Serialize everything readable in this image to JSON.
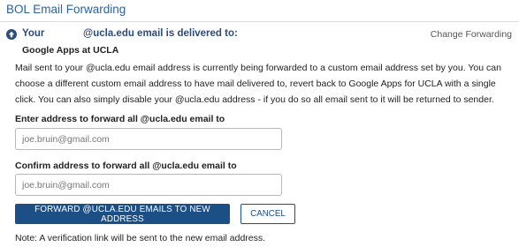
{
  "page": {
    "title": "BOL Email Forwarding"
  },
  "status": {
    "heading_your": "Your",
    "heading_rest": "@ucla.edu email is delivered to:",
    "current_destination": "Google Apps at UCLA",
    "change_link": "Change Forwarding",
    "icon": "arrow-up-circle-icon"
  },
  "description": "Mail sent to your @ucla.edu email address is currently being forwarded to a custom email address set by you. You can choose a different custom email address to have mail delivered to, revert back to Google Apps for UCLA with a single click. You can also simply disable your @ucla.edu address - if you do so all email sent to it will be returned to sender.",
  "form": {
    "forward_label": "Enter address to forward all @ucla.edu email to",
    "forward_placeholder": "joe.bruin@gmail.com",
    "confirm_label": "Confirm address to forward all @ucla.edu email to",
    "confirm_placeholder": "joe.bruin@gmail.com",
    "submit_label": "FORWARD @UCLA.EDU EMAILS TO NEW ADDRESS",
    "cancel_label": "CANCEL"
  },
  "note": "Note: A verification link will be sent to the new email address.",
  "colors": {
    "title": "#2b62a0",
    "primary": "#1c4f86"
  }
}
